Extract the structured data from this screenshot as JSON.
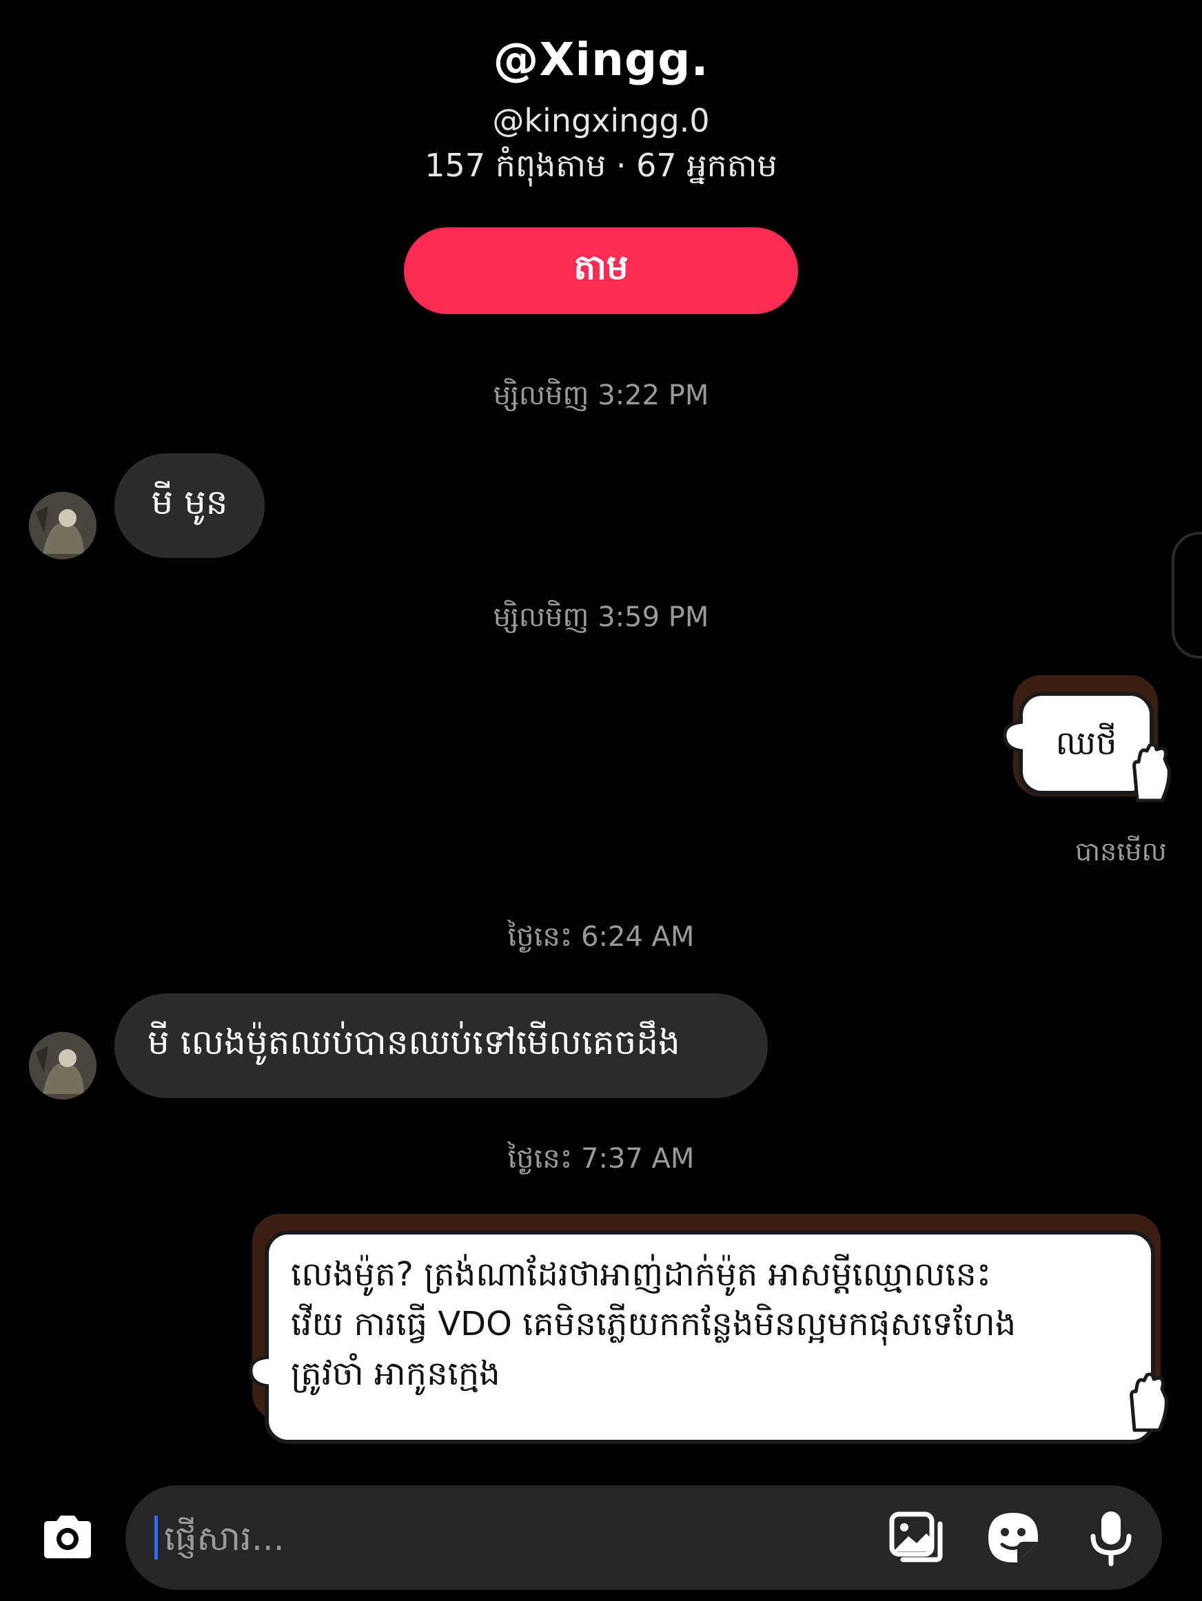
{
  "header": {
    "title": "@Xingg.",
    "handle": "@kingxingg.0",
    "stats": "157 កំពុងតាម · 67 អ្នកតាម",
    "follow_label": "តាម"
  },
  "messages": {
    "ts1": "ម្សិលមិញ 3:22 PM",
    "msg1": "មី មូន",
    "ts2": "ម្សិលមិញ 3:59 PM",
    "sticker1_text": "ឈថី",
    "seen": "បានមើល",
    "ts3": "ថ្ងៃនេះ 6:24 AM",
    "msg2": "មី លេងម៉ូតឈប់បានឈប់ទៅមើលគេចដឹង",
    "ts4": "ថ្ងៃនេះ 7:37 AM",
    "sticker2_line1": "លេងម៉ូត? ត្រង់ណាដែរថាអាញ់ដាក់ម៉ូត អាសម្ដីឈ្មោលនេះ",
    "sticker2_line2": "វើយ ការធ្វើ VDO គេមិនភ្លើយកកន្លែងមិនល្អមកផុសទេហែង",
    "sticker2_line3": "ត្រូវចាំ អាកូនក្មេង"
  },
  "composer": {
    "placeholder": "ផ្ញើសារ..."
  },
  "icons": {
    "camera": "camera-icon",
    "gallery": "gallery-icon",
    "sticker": "sticker-icon",
    "mic": "microphone-icon"
  },
  "colors": {
    "background": "#000000",
    "follow_button": "#fd2b55",
    "bubble_in": "#2b2b2b",
    "timestamp": "#9a9a9a",
    "caret": "#2f6bff"
  }
}
